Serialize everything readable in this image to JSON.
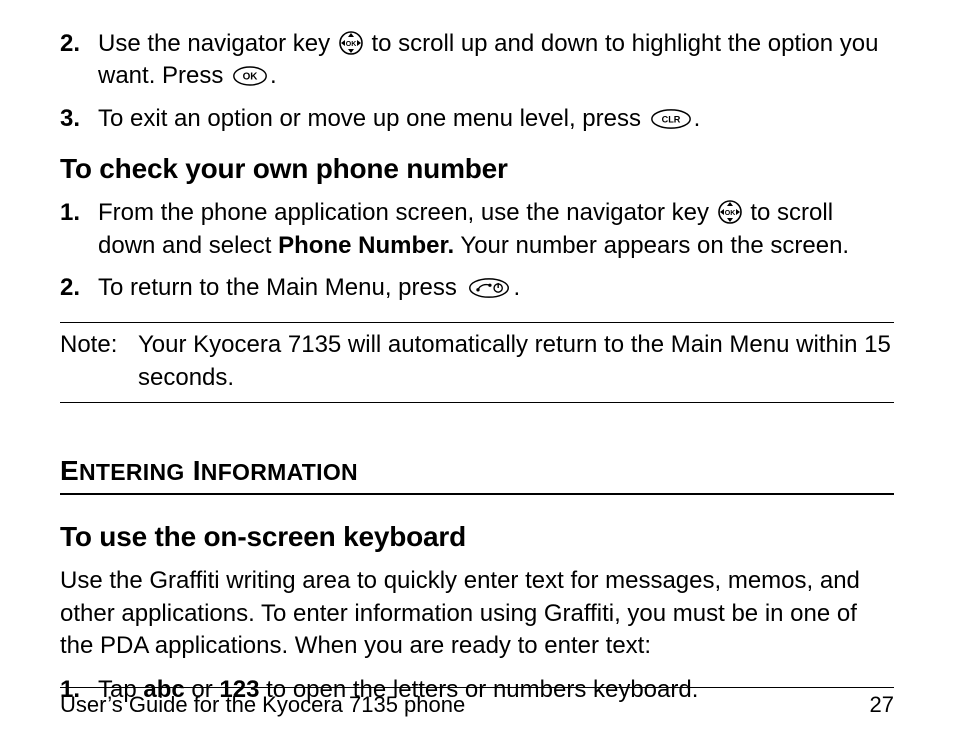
{
  "list_a": {
    "items": [
      {
        "num": "2.",
        "parts": [
          {
            "type": "text",
            "val": "Use the navigator key "
          },
          {
            "type": "icon",
            "val": "nav-ok"
          },
          {
            "type": "text",
            "val": " to scroll up and down to highlight the option you want. Press "
          },
          {
            "type": "icon",
            "val": "ok-oval"
          },
          {
            "type": "text",
            "val": "."
          }
        ]
      },
      {
        "num": "3.",
        "parts": [
          {
            "type": "text",
            "val": "To exit an option or move up one menu level, press "
          },
          {
            "type": "icon",
            "val": "clr-oval"
          },
          {
            "type": "text",
            "val": "."
          }
        ]
      }
    ]
  },
  "subhead1": "To check your own phone number",
  "list_b": {
    "items": [
      {
        "num": "1.",
        "parts": [
          {
            "type": "text",
            "val": "From the phone application screen, use the navigator key "
          },
          {
            "type": "icon",
            "val": "nav-ok"
          },
          {
            "type": "text",
            "val": " to scroll down and select "
          },
          {
            "type": "bold",
            "val": "Phone Number."
          },
          {
            "type": "text",
            "val": " Your number appears on the screen."
          }
        ]
      },
      {
        "num": "2.",
        "parts": [
          {
            "type": "text",
            "val": "To return to the Main Menu, press "
          },
          {
            "type": "icon",
            "val": "end-oval"
          },
          {
            "type": "text",
            "val": "."
          }
        ]
      }
    ]
  },
  "note": {
    "label": "Note:",
    "text": "Your Kyocera 7135 will automatically return to the Main Menu within 15 seconds."
  },
  "section_title": {
    "caps1": "E",
    "rest1": "NTERING",
    "gap": " ",
    "caps2": "I",
    "rest2": "NFORMATION"
  },
  "subhead2": "To use the on-screen keyboard",
  "intro": "Use the Graffiti writing area to quickly enter text for messages, memos, and other applications. To enter information using Graffiti, you must be in one of the PDA applications. When you are ready to enter text:",
  "list_c": {
    "items": [
      {
        "num": "1.",
        "parts": [
          {
            "type": "text",
            "val": "Tap "
          },
          {
            "type": "bold",
            "val": "abc"
          },
          {
            "type": "text",
            "val": " or "
          },
          {
            "type": "bold",
            "val": "123"
          },
          {
            "type": "text",
            "val": " to open the letters or numbers keyboard."
          }
        ]
      }
    ]
  },
  "footer": {
    "left": "User’s Guide for the Kyocera 7135 phone",
    "right": "27"
  }
}
